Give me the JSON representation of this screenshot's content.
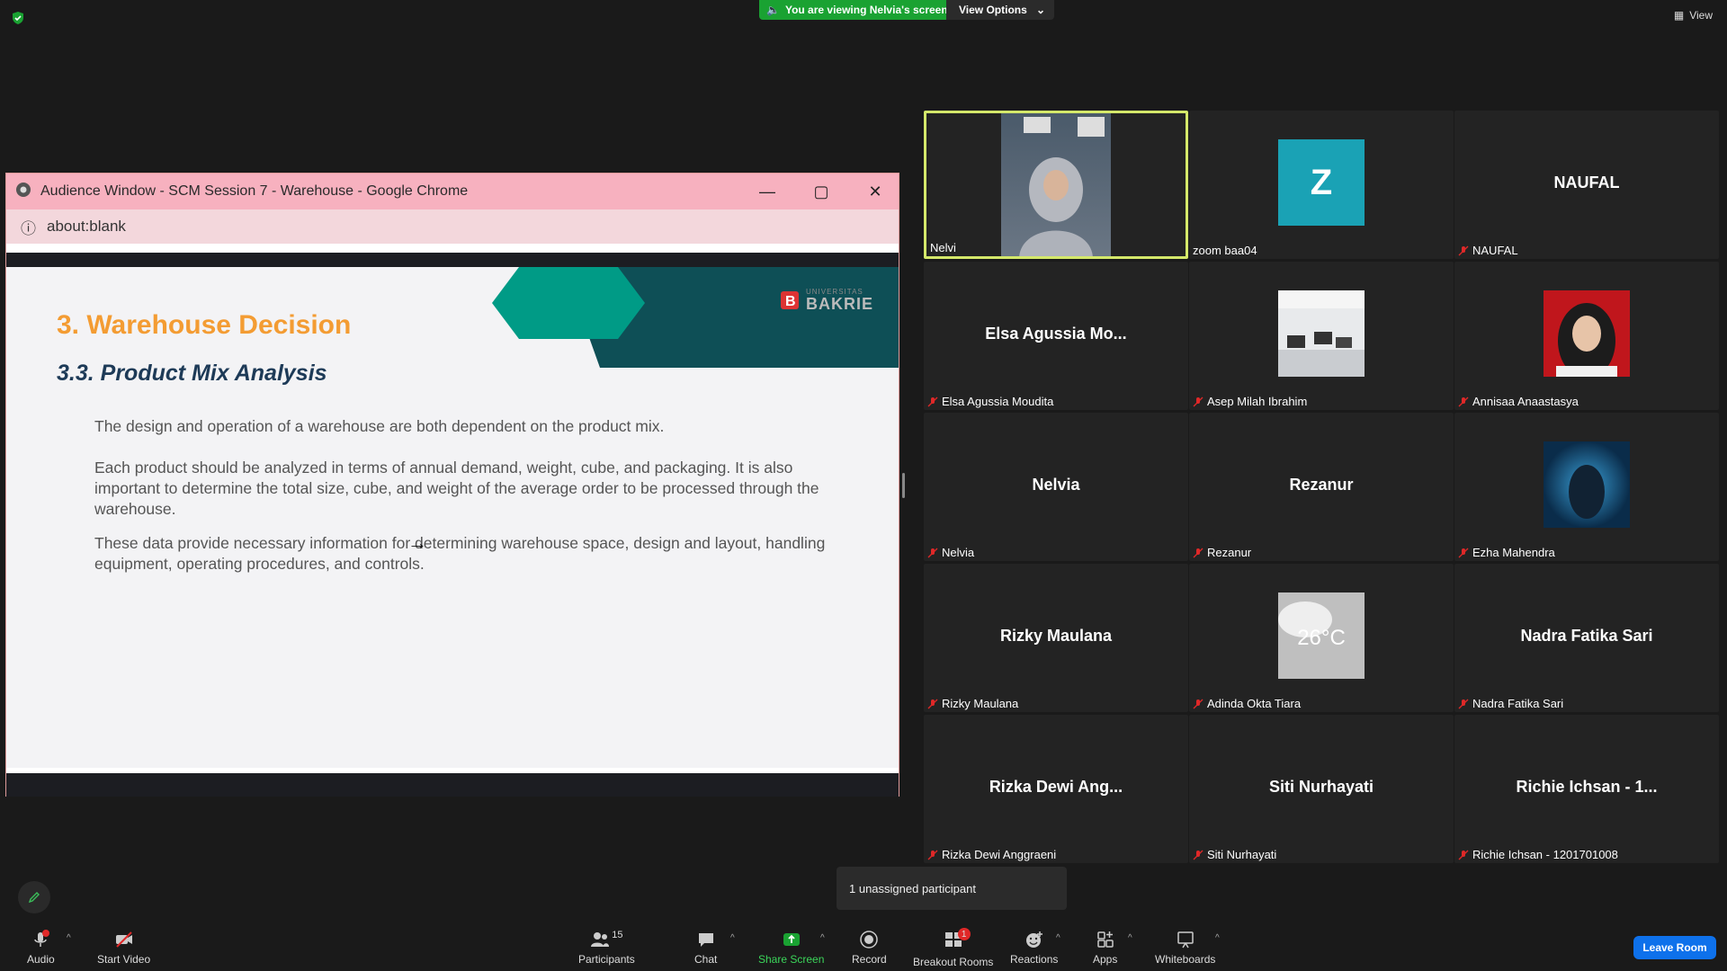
{
  "topbar": {
    "viewing_text": "You are viewing Nelvia's screen",
    "view_options_label": "View Options",
    "view_label": "View"
  },
  "window": {
    "title": "Audience Window - SCM Session 7 - Warehouse - Google Chrome",
    "url": "about:blank"
  },
  "slide": {
    "logo_text": "BAKRIE",
    "logo_small": "UNIVERSITAS",
    "title": "3. Warehouse Decision",
    "subtitle": "3.3. Product Mix Analysis",
    "p1": "The design and operation of a warehouse are both dependent on the product mix.",
    "p2": "Each product should be analyzed in terms of annual demand, weight, cube, and packaging. It is also important to determine the total size, cube, and weight of the average order to be processed through the warehouse.",
    "p3": "These data provide necessary information for determining warehouse space, design and layout, handling equipment, operating procedures, and controls."
  },
  "gallery": {
    "tiles": [
      {
        "label": "Nelvi",
        "big": "",
        "muted": false,
        "active": true
      },
      {
        "label": "zoom baa04",
        "big": "Z",
        "muted": false
      },
      {
        "label": "NAUFAL",
        "big": "NAUFAL",
        "muted": true
      },
      {
        "label": "Elsa Agussia Moudita",
        "big": "Elsa Agussia Mo...",
        "muted": true
      },
      {
        "label": "Asep Milah Ibrahim",
        "big": "",
        "muted": true
      },
      {
        "label": "Annisaa Anaastasya",
        "big": "",
        "muted": true
      },
      {
        "label": "Nelvia",
        "big": "Nelvia",
        "muted": true
      },
      {
        "label": "Rezanur",
        "big": "Rezanur",
        "muted": true
      },
      {
        "label": "Ezha Mahendra",
        "big": "",
        "muted": true
      },
      {
        "label": "Rizky Maulana",
        "big": "Rizky Maulana",
        "muted": true
      },
      {
        "label": "Adinda Okta Tiara",
        "big": "",
        "muted": true
      },
      {
        "label": "Nadra Fatika Sari",
        "big": "Nadra Fatika Sari",
        "muted": true
      },
      {
        "label": "Rizka Dewi Anggraeni",
        "big": "Rizka Dewi Ang...",
        "muted": true
      },
      {
        "label": "Siti Nurhayati",
        "big": "Siti Nurhayati",
        "muted": true
      },
      {
        "label": "Richie Ichsan - 1201701008",
        "big": "Richie Ichsan - 1...",
        "muted": true
      }
    ],
    "thumb_temp_text": "26°C"
  },
  "toolbar": {
    "audio": "Audio",
    "audio_badge": "!",
    "start_video": "Start Video",
    "participants": "Participants",
    "participants_count": "15",
    "chat": "Chat",
    "share_screen": "Share Screen",
    "record": "Record",
    "breakout_rooms": "Breakout Rooms",
    "breakout_badge": "1",
    "reactions": "Reactions",
    "apps": "Apps",
    "whiteboards": "Whiteboards",
    "leave": "Leave Room"
  },
  "unassigned_text": "1 unassigned participant",
  "colors": {
    "accent_green": "#1aa232",
    "active_speaker": "#d4e86a",
    "leave_blue": "#0e71eb",
    "slide_title_orange": "#f39c33",
    "slide_teal": "#009b86",
    "slide_dark_teal": "#0e4f56"
  }
}
